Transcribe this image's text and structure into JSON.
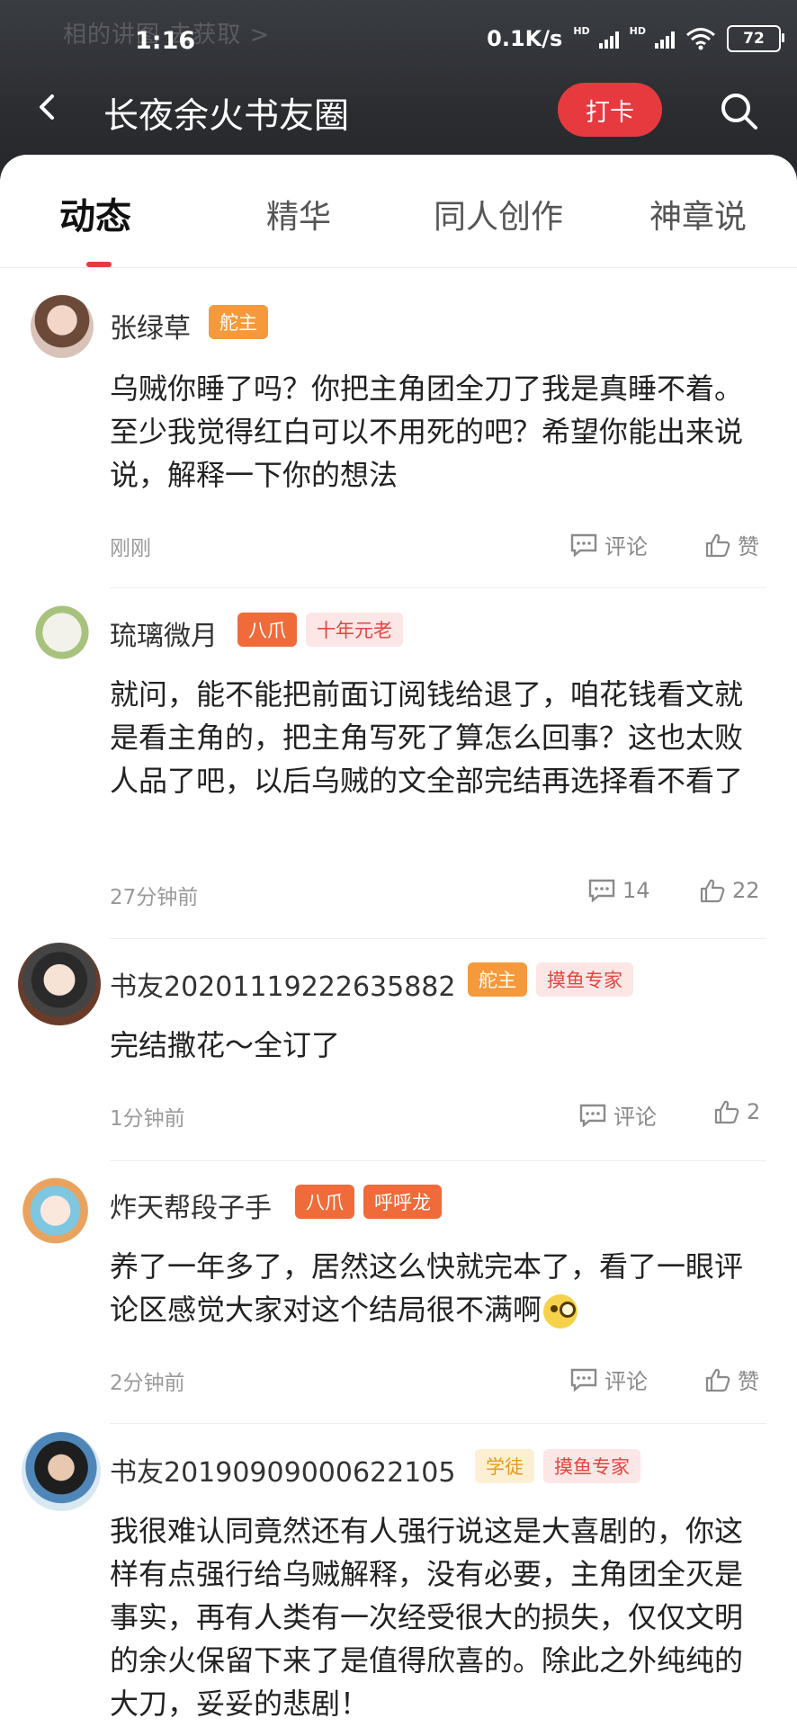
{
  "status_bar": {
    "ghost_text": "相的讲图 去获取 >",
    "time": "1:16",
    "speed": "0.1K/s",
    "battery": "72"
  },
  "header": {
    "title": "长夜余火书友圈",
    "checkin_label": "打卡"
  },
  "tabs": [
    {
      "label": "动态"
    },
    {
      "label": "精华"
    },
    {
      "label": "同人创作"
    },
    {
      "label": "神章说"
    }
  ],
  "posts": [
    {
      "username": "张绿草",
      "badges": [
        "舵主"
      ],
      "content": "乌贼你睡了吗？你把主角团全刀了我是真睡不着。至少我觉得红白可以不用死的吧？希望你能出来说说，解释一下你的想法",
      "time": "刚刚",
      "comment": "评论",
      "like": "赞"
    },
    {
      "username": "琉璃微月",
      "badges": [
        "八爪",
        "十年元老"
      ],
      "content": "就问，能不能把前面订阅钱给退了，咱花钱看文就是看主角的，把主角写死了算怎么回事？这也太败人品了吧，以后乌贼的文全部完结再选择看不看了",
      "time": "27分钟前",
      "comment": "14",
      "like": "22"
    },
    {
      "username": "书友20201119222635882",
      "badges": [
        "舵主",
        "摸鱼专家"
      ],
      "content": "完结撒花～全订了",
      "time": "1分钟前",
      "comment": "评论",
      "like": "2"
    },
    {
      "username": "炸天帮段子手",
      "badges": [
        "八爪",
        "呼呼龙"
      ],
      "content": "养了一年多了，居然这么快就完本了，看了一眼评论区感觉大家对这个结局很不满啊",
      "time": "2分钟前",
      "comment": "评论",
      "like": "赞"
    },
    {
      "username": "书友20190909000622105",
      "badges": [
        "学徒",
        "摸鱼专家"
      ],
      "content": "我很难认同竟然还有人强行说这是大喜剧的，你这样有点强行给乌贼解释，没有必要，主角团全灭是事实，再有人类有一次经受很大的损失，仅仅文明的余火保留下来了是值得欣喜的。除此之外纯纯的大刀，妥妥的悲剧！"
    }
  ],
  "colors": {
    "accent": "#e63a3f",
    "header_bg": "#2b2d31"
  }
}
